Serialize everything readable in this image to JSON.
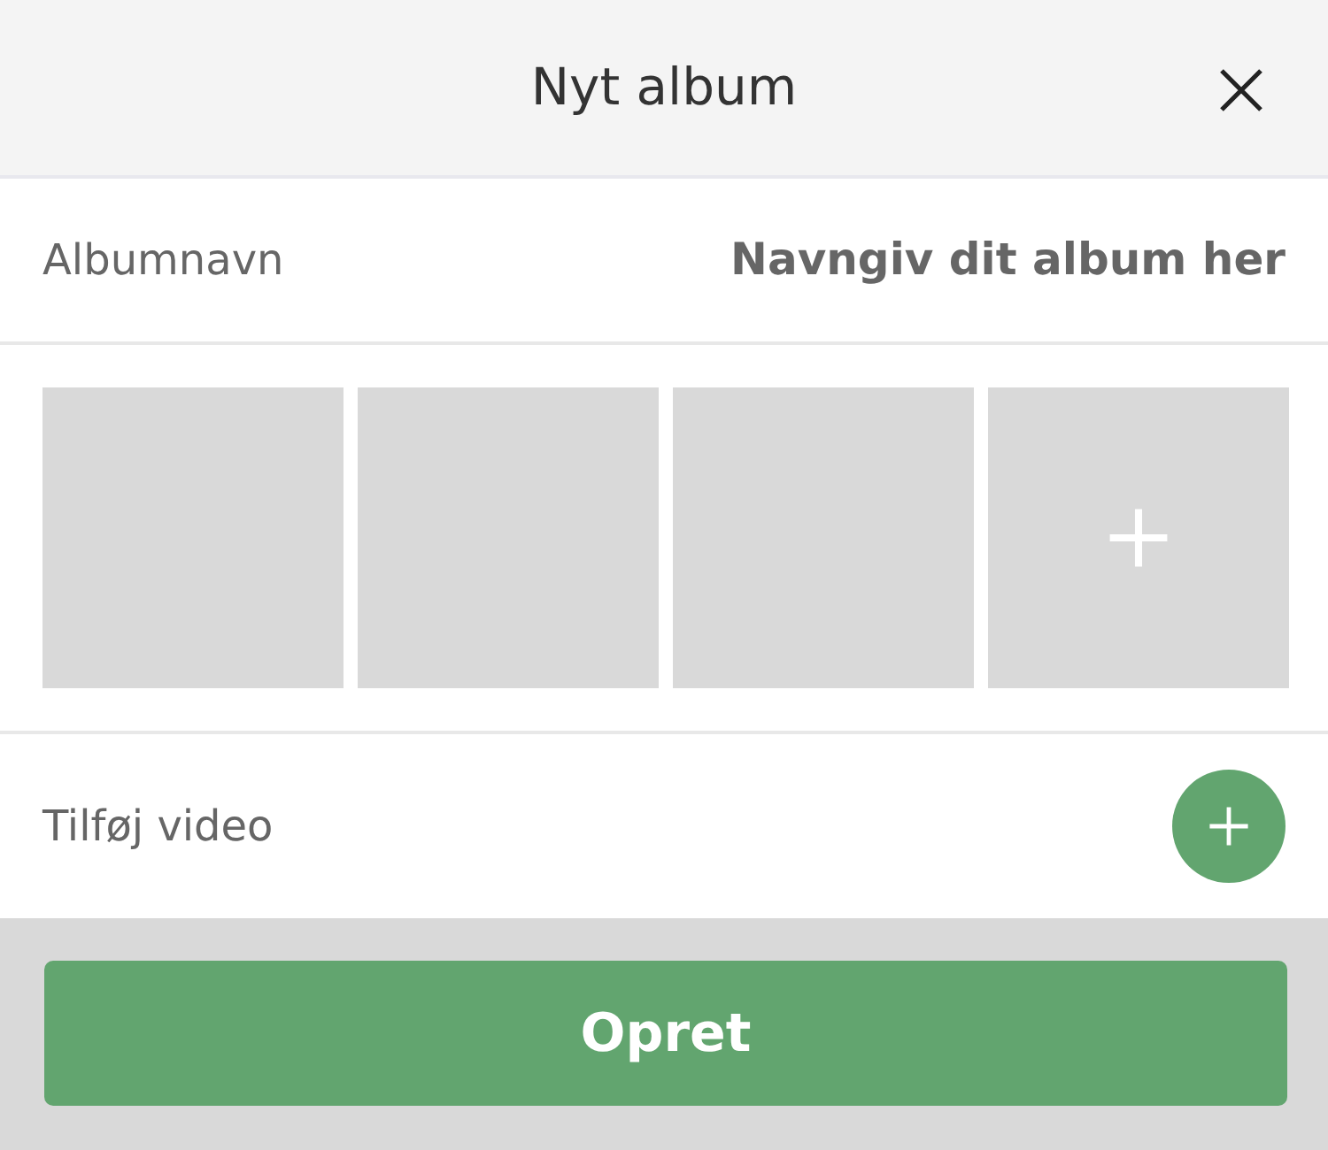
{
  "header": {
    "title": "Nyt album"
  },
  "album_name": {
    "label": "Albumnavn",
    "placeholder": "Navngiv dit album her"
  },
  "photo_slots": [
    {
      "kind": "empty"
    },
    {
      "kind": "empty"
    },
    {
      "kind": "empty"
    },
    {
      "kind": "add"
    }
  ],
  "video": {
    "label": "Tilføj video"
  },
  "submit": {
    "label": "Opret"
  }
}
